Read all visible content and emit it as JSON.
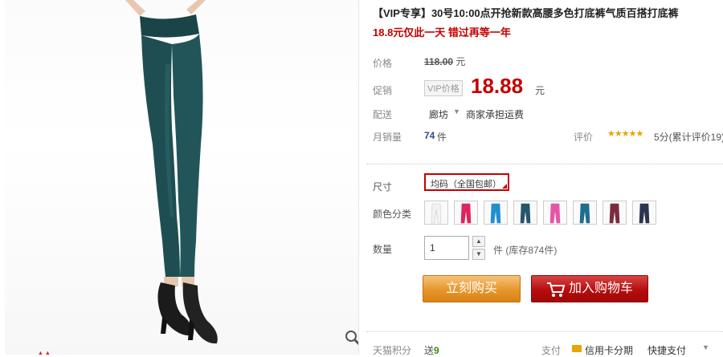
{
  "product": {
    "title": "【VIP专享】30号10:00点开抢新款高腰多色打底裤气质百搭打底裤",
    "subtitle": "18.8元仅此一天 错过再等一年"
  },
  "price": {
    "label": "价格",
    "original": "118.00",
    "unit": "元",
    "promo_label": "促销",
    "vip_tag": "VIP价格",
    "current": "18.88"
  },
  "shipping": {
    "label": "配送",
    "from": "廊坊",
    "note": "商家承担运费"
  },
  "sales": {
    "label": "月销量",
    "count": "74",
    "unit": "件",
    "review_label": "评价",
    "stars": "★★★★★",
    "review_text": "5分(累计评价19)"
  },
  "options": {
    "size_label": "尺寸",
    "size_value": "均码（全国包邮）",
    "color_label": "颜色分类",
    "colors": [
      "#f2f2f2",
      "#e0245e",
      "#1f8fd1",
      "#27556a",
      "#e455a8",
      "#1c6e8c",
      "#7a2c3e",
      "#2a3550"
    ]
  },
  "quantity": {
    "label": "数量",
    "value": "1",
    "stock": "件 (库存874件)"
  },
  "buttons": {
    "buy_now": "立刻购买",
    "add_cart": "加入购物车"
  },
  "footer": {
    "points_label": "天猫积分",
    "points_prefix": "送",
    "points_value": "9",
    "pay_label": "支付",
    "pay_card": "信用卡分期",
    "pay_fast": "快捷支付"
  },
  "colors": {
    "accent_red": "#c40000",
    "buy_orange": "#e7952b",
    "cart_red": "#b50d0d",
    "pants_teal": "#1f4e52"
  }
}
